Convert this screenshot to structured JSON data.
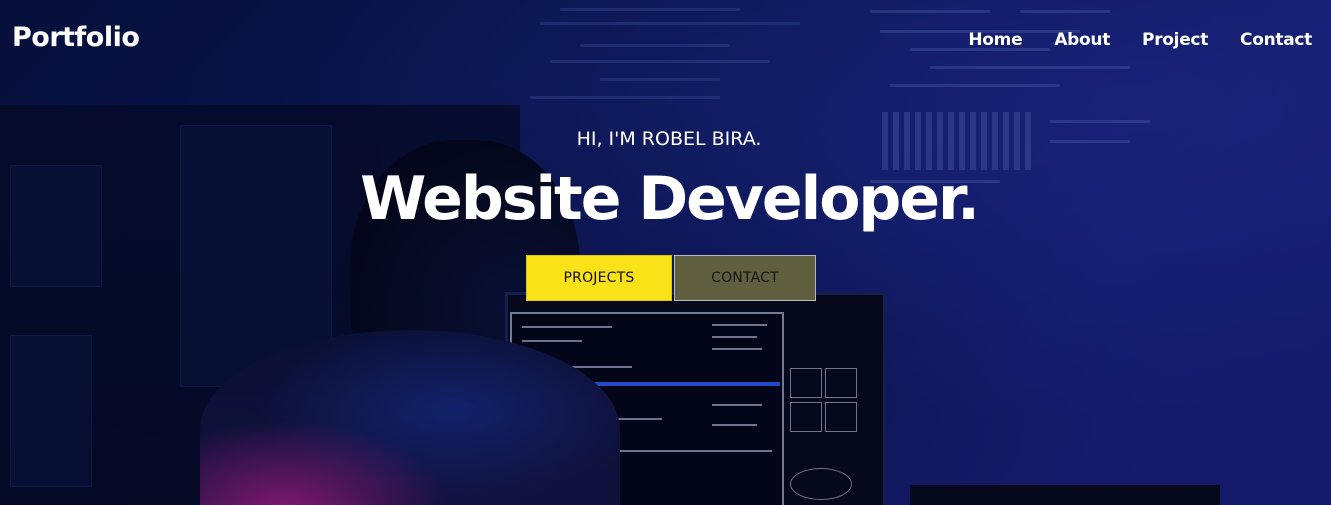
{
  "brand": {
    "logo_text": "Portfolio"
  },
  "nav": {
    "items": [
      {
        "label": "Home"
      },
      {
        "label": "About"
      },
      {
        "label": "Project"
      },
      {
        "label": "Contact"
      }
    ]
  },
  "hero": {
    "greeting": "HI, I'M ROBEL BIRA.",
    "headline": "Website Developer.",
    "buttons": {
      "projects_label": "PROJECTS",
      "contact_label": "CONTACT"
    }
  },
  "colors": {
    "primary_button": "#fae218",
    "secondary_button": "#5f5e3e",
    "background": "#0d1b5e",
    "text": "#ffffff"
  }
}
